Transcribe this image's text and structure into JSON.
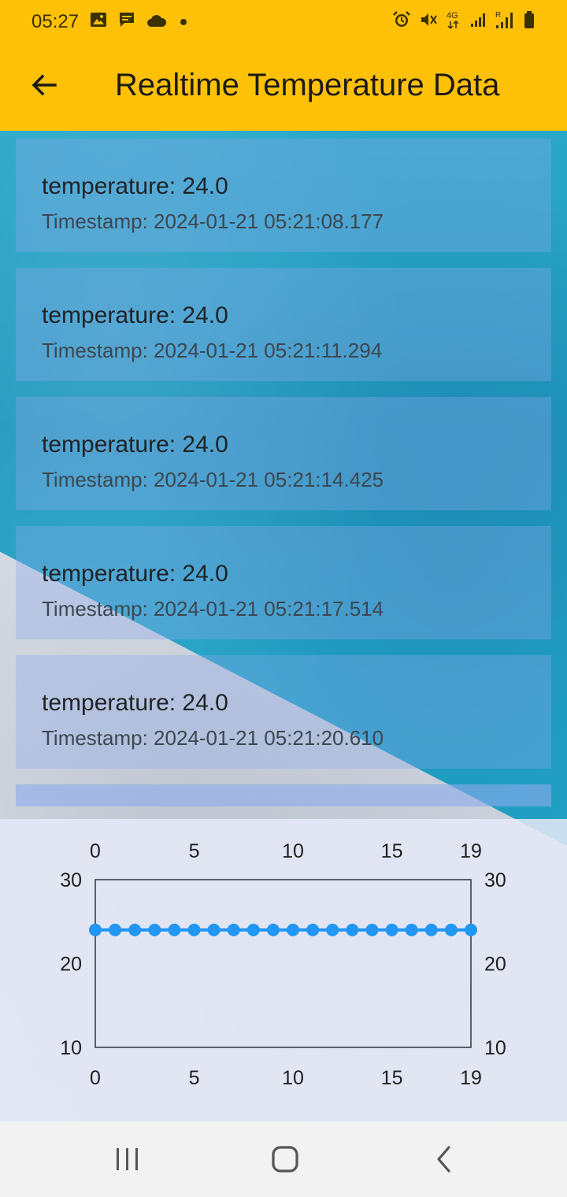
{
  "status_bar": {
    "time": "05:27",
    "left_icons": [
      "image-icon",
      "message-icon",
      "cloud-icon",
      "dot-icon"
    ],
    "right_icons": [
      "alarm-icon",
      "vibrate-mute-icon",
      "network-4g-icon",
      "signal-icon",
      "roaming-signal-icon",
      "battery-icon"
    ],
    "network_label": "4G",
    "roaming_label": "R"
  },
  "app_bar": {
    "back_icon": "arrow-left-icon",
    "title": "Realtime Temperature Data",
    "color": "#ffc107"
  },
  "readings": [
    {
      "temperature": "temperature: 24.0",
      "timestamp": "Timestamp: 2024-01-21 05:21:08.177"
    },
    {
      "temperature": "temperature: 24.0",
      "timestamp": "Timestamp: 2024-01-21 05:21:11.294"
    },
    {
      "temperature": "temperature: 24.0",
      "timestamp": "Timestamp: 2024-01-21 05:21:14.425"
    },
    {
      "temperature": "temperature: 24.0",
      "timestamp": "Timestamp: 2024-01-21 05:21:17.514"
    },
    {
      "temperature": "temperature: 24.0",
      "timestamp": "Timestamp: 2024-01-21 05:21:20.610"
    }
  ],
  "chart_data": {
    "type": "line",
    "title": "",
    "xlabel": "",
    "ylabel": "",
    "x": [
      0,
      1,
      2,
      3,
      4,
      5,
      6,
      7,
      8,
      9,
      10,
      11,
      12,
      13,
      14,
      15,
      16,
      17,
      18,
      19
    ],
    "series": [
      {
        "values": [
          24,
          24,
          24,
          24,
          24,
          24,
          24,
          24,
          24,
          24,
          24,
          24,
          24,
          24,
          24,
          24,
          24,
          24,
          24,
          24
        ],
        "color": "#2196f3"
      }
    ],
    "xlim": [
      0,
      19
    ],
    "ylim": [
      10,
      30
    ],
    "xticks": [
      "0",
      "5",
      "10",
      "15",
      "19"
    ],
    "xtick_values": [
      0,
      5,
      10,
      15,
      19
    ],
    "yticks": [
      "30",
      "20",
      "10"
    ],
    "ytick_values": [
      30,
      20,
      10
    ],
    "grid": false,
    "axes_on": [
      "top",
      "bottom",
      "left",
      "right"
    ]
  },
  "nav_bar": {
    "icons": [
      "recent-apps-icon",
      "home-icon",
      "back-icon"
    ]
  }
}
